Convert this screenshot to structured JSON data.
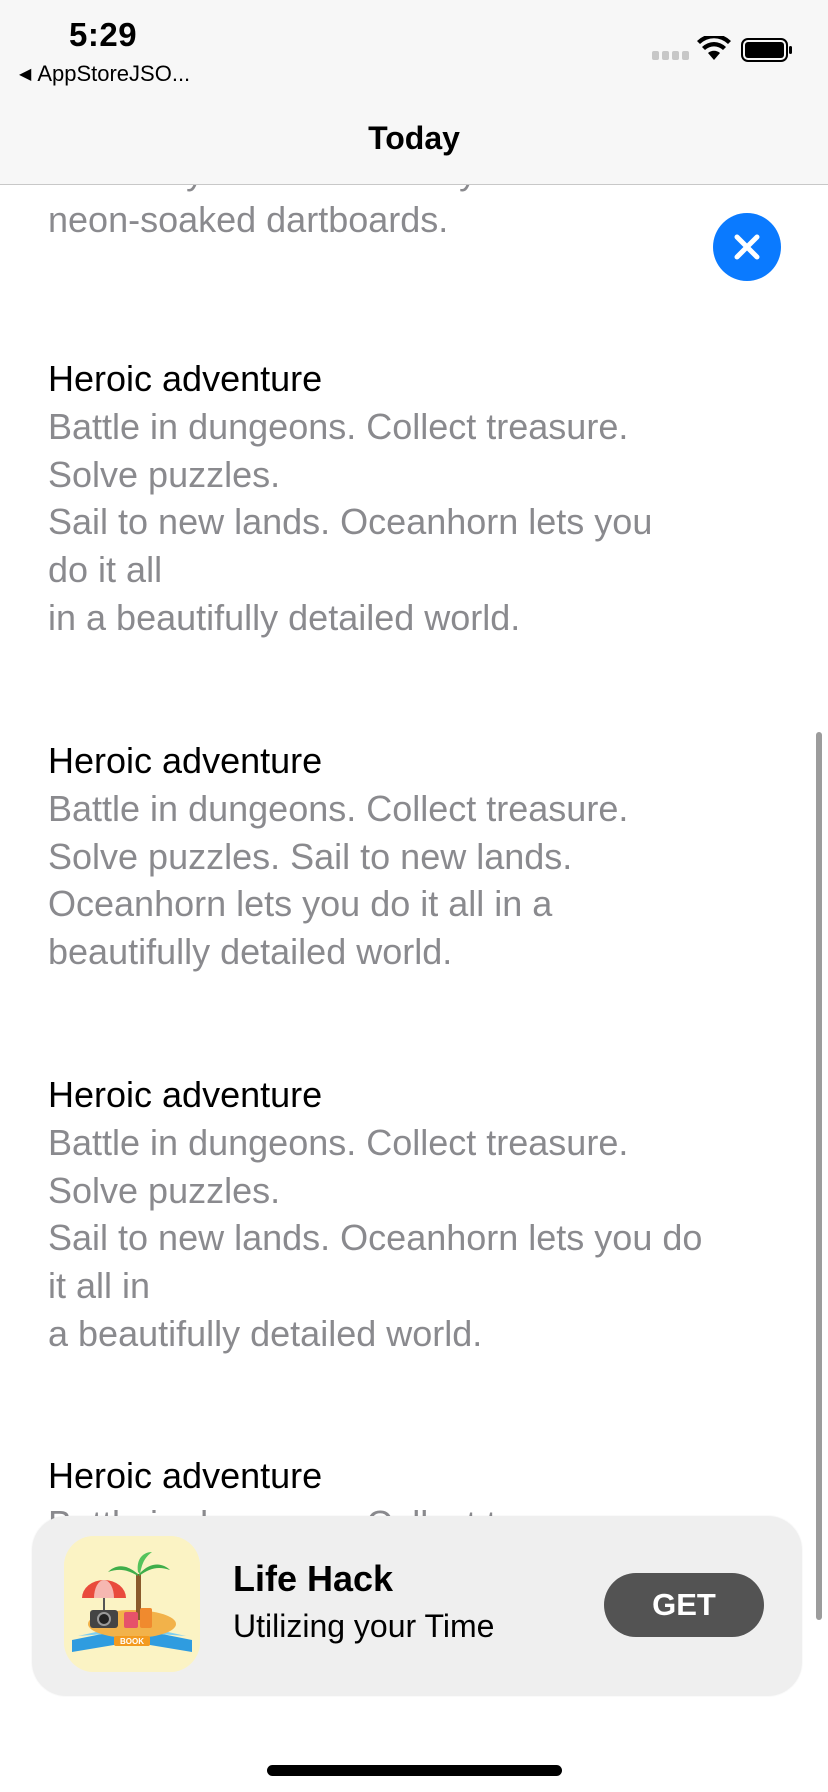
{
  "status_bar": {
    "time": "5:29",
    "back_app": "AppStoreJSO...",
    "back_icon": "back-triangle-icon",
    "signal_icon": "cellular-signal-icon",
    "wifi_icon": "wifi-icon",
    "battery_icon": "battery-icon"
  },
  "nav": {
    "title": "Today"
  },
  "content": {
    "partial_intro": "whether you're into fantasy worlds or\nneon-soaked dartboards.",
    "close_icon": "close-icon",
    "sections": [
      {
        "title": "Heroic adventure",
        "body": "Battle in dungeons. Collect treasure.\nSolve puzzles.\n    Sail to new lands. Oceanhorn lets you\ndo it all\n    in a beautifully detailed world."
      },
      {
        "title": "Heroic adventure",
        "body": "Battle in dungeons. Collect treasure.\nSolve puzzles. Sail to new lands.\nOceanhorn lets you do it all in a\nbeautifully detailed world."
      },
      {
        "title": "Heroic adventure",
        "body": "Battle in dungeons. Collect treasure.\nSolve puzzles.\nSail to new lands. Oceanhorn lets you do\nit all in\na beautifully detailed world."
      },
      {
        "title": "Heroic adventure",
        "body": "Battle in dungeons. Collect treasure."
      }
    ]
  },
  "banner": {
    "app_name": "Life Hack",
    "subtitle": "Utilizing your Time",
    "get_label": "GET",
    "icon_badge": "BOOK",
    "accent": "#0a7aff"
  }
}
